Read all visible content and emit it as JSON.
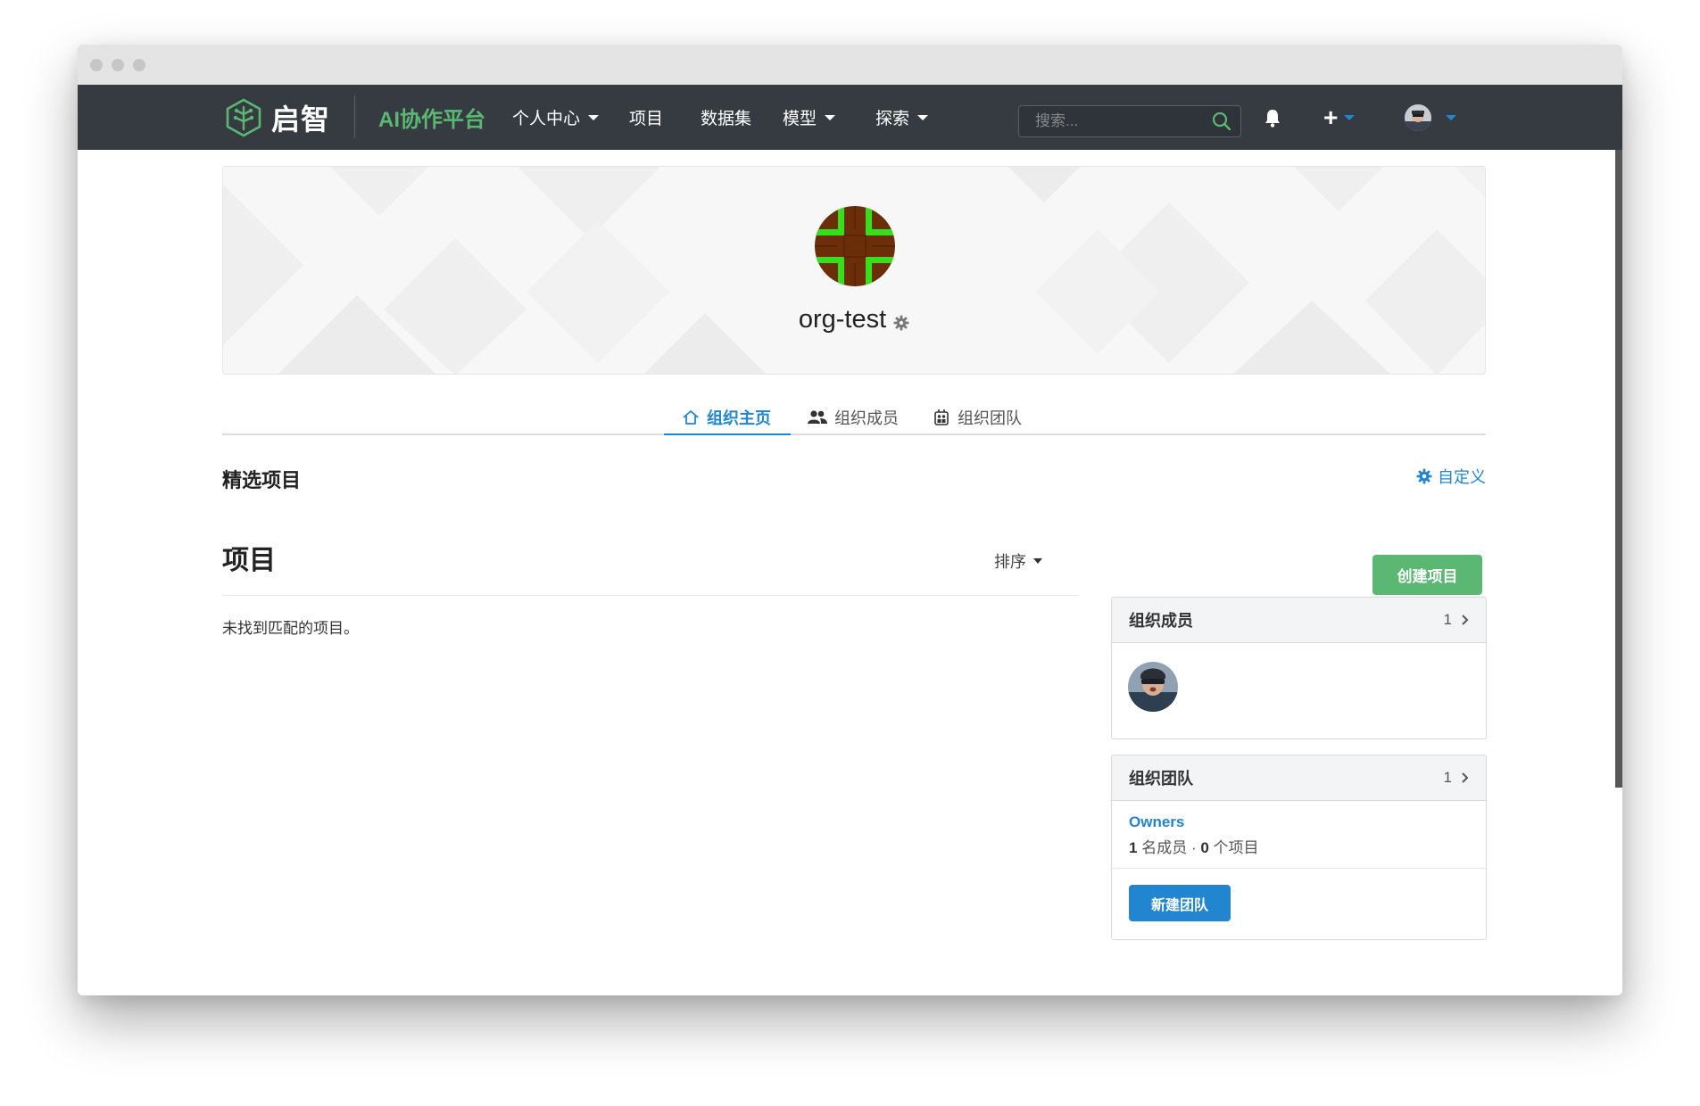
{
  "brand": {
    "logo_text": "启智",
    "platform": "AI协作平台"
  },
  "nav": {
    "items": [
      "个人中心",
      "项目",
      "数据集",
      "模型",
      "探索"
    ],
    "search_placeholder": "搜索...",
    "plus": "+"
  },
  "org": {
    "name": "org-test"
  },
  "tabs": [
    "组织主页",
    "组织成员",
    "组织团队"
  ],
  "featured": {
    "title": "精选项目",
    "customize": "自定义"
  },
  "projects": {
    "title": "项目",
    "sort": "排序",
    "empty": "未找到匹配的项目。",
    "create": "创建项目"
  },
  "members_card": {
    "title": "组织成员",
    "count": "1"
  },
  "teams_card": {
    "title": "组织团队",
    "count": "1",
    "team": {
      "name": "Owners",
      "members_num": "1",
      "members_label": "名成员",
      "sep": "·",
      "repos_num": "0",
      "repos_label": "个项目"
    },
    "new_team": "新建团队"
  },
  "colors": {
    "navbar": "#363b42",
    "accent_blue": "#2185d0",
    "accent_green": "#5bb873",
    "avatar_brown": "#6b2e08",
    "avatar_green": "#35e01a"
  }
}
